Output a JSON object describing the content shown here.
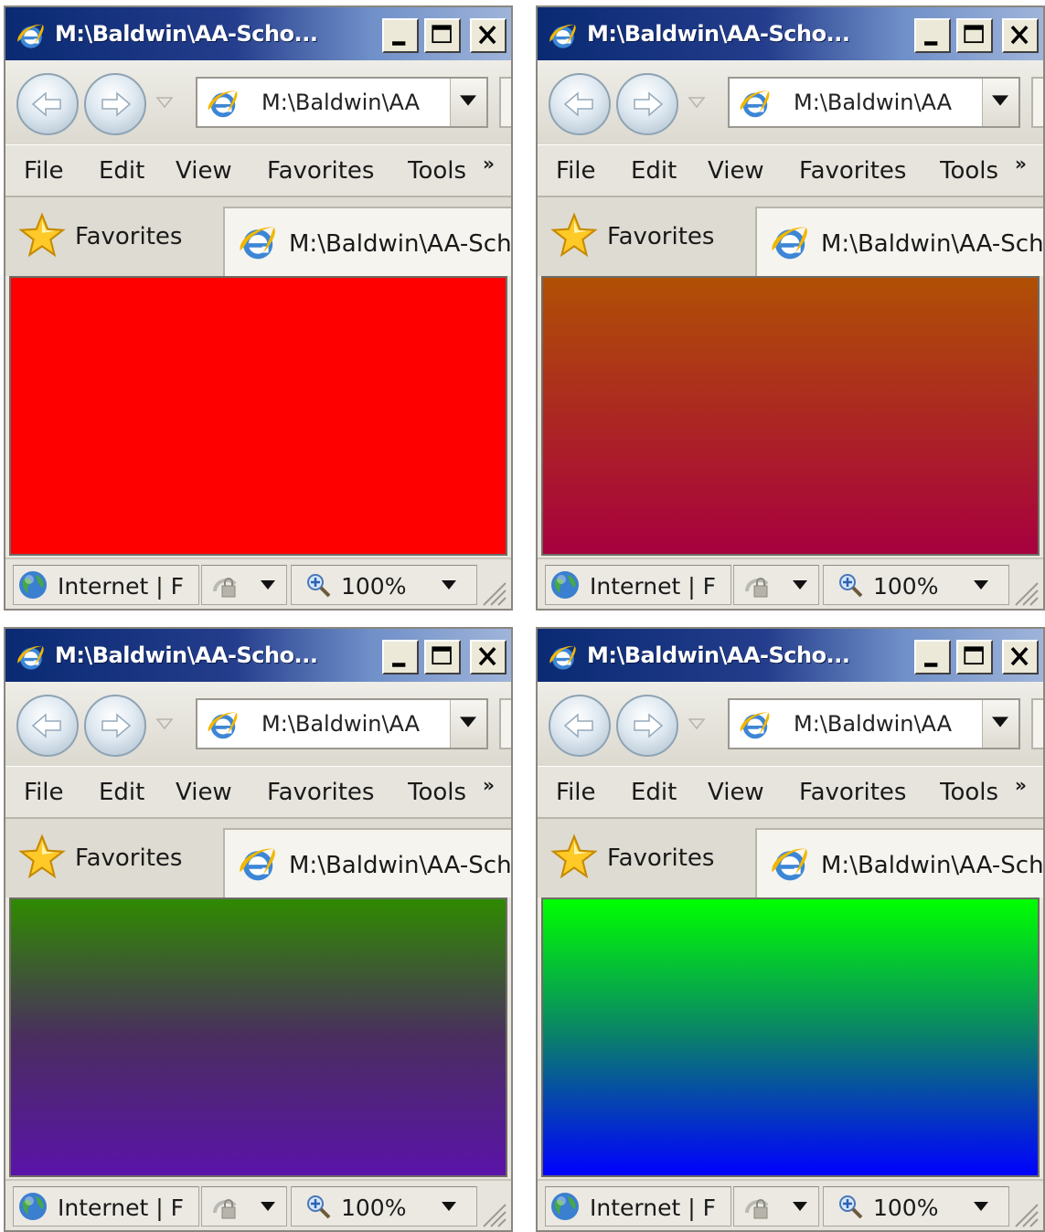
{
  "windows": [
    {
      "title": "M:\\Baldwin\\AA-Scho...",
      "address": "M:\\Baldwin\\AA",
      "tab_label": "M:\\Baldwin\\AA-Sch",
      "content_gradient": [
        "#ff0000",
        "#ff0000"
      ]
    },
    {
      "title": "M:\\Baldwin\\AA-Scho...",
      "address": "M:\\Baldwin\\AA",
      "tab_label": "M:\\Baldwin\\AA-Sch",
      "content_gradient": [
        "#b05005",
        "#a8003f"
      ]
    },
    {
      "title": "M:\\Baldwin\\AA-Scho...",
      "address": "M:\\Baldwin\\AA",
      "tab_label": "M:\\Baldwin\\AA-Sch",
      "content_gradient": [
        "#2f8a00",
        "#4a2e5f",
        "#5a13a9"
      ]
    },
    {
      "title": "M:\\Baldwin\\AA-Scho...",
      "address": "M:\\Baldwin\\AA",
      "tab_label": "M:\\Baldwin\\AA-Sch",
      "content_gradient": [
        "#00ff00",
        "#0a7f6c",
        "#0000ff"
      ]
    }
  ],
  "menu": {
    "file": "File",
    "edit": "Edit",
    "view": "View",
    "favorites": "Favorites",
    "tools": "Tools",
    "more": "»"
  },
  "favorites_label": "Favorites",
  "status": {
    "zone": "Internet | F",
    "zoom": "100%"
  },
  "icons": {
    "title": "ie-logo-icon",
    "back": "back-arrow-icon",
    "forward": "forward-arrow-icon",
    "favorites": "star-icon",
    "zone": "globe-icon",
    "protected_mode": "lock-icon",
    "zoom": "magnifier-icon"
  }
}
